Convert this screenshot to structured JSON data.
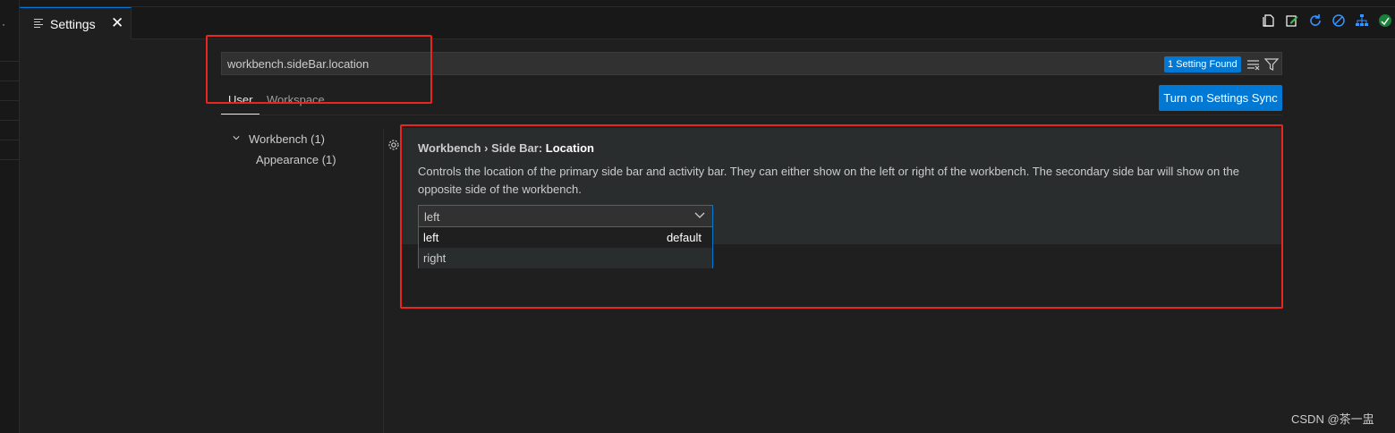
{
  "window": {
    "left_strip_glyph": "·"
  },
  "tab": {
    "title": "Settings",
    "close_glyph": "✕"
  },
  "toolbar": {
    "icons": [
      "open-settings-json-icon",
      "edit-icon",
      "refresh-icon",
      "disable-icon",
      "hierarchy-icon",
      "sync-icon"
    ]
  },
  "search": {
    "value": "workbench.sideBar.location",
    "results_badge": "1 Setting Found"
  },
  "scope_tabs": {
    "user": "User",
    "workspace": "Workspace"
  },
  "sync_button": {
    "label": "Turn on Settings Sync"
  },
  "toc": {
    "group": "Workbench (1)",
    "child": "Appearance (1)"
  },
  "setting": {
    "category": "Workbench › Side Bar: ",
    "name": "Location",
    "description": "Controls the location of the primary side bar and activity bar. They can either show on the left or right of the workbench. The secondary side bar will show on the opposite side of the workbench.",
    "value": "left",
    "options": [
      {
        "label": "left",
        "tag": "default"
      },
      {
        "label": "right",
        "tag": ""
      }
    ]
  },
  "colors": {
    "accent": "#0078d4",
    "highlight_box": "#e8261f",
    "background": "#1f1f1f"
  },
  "watermark": "CSDN @茶一盅"
}
